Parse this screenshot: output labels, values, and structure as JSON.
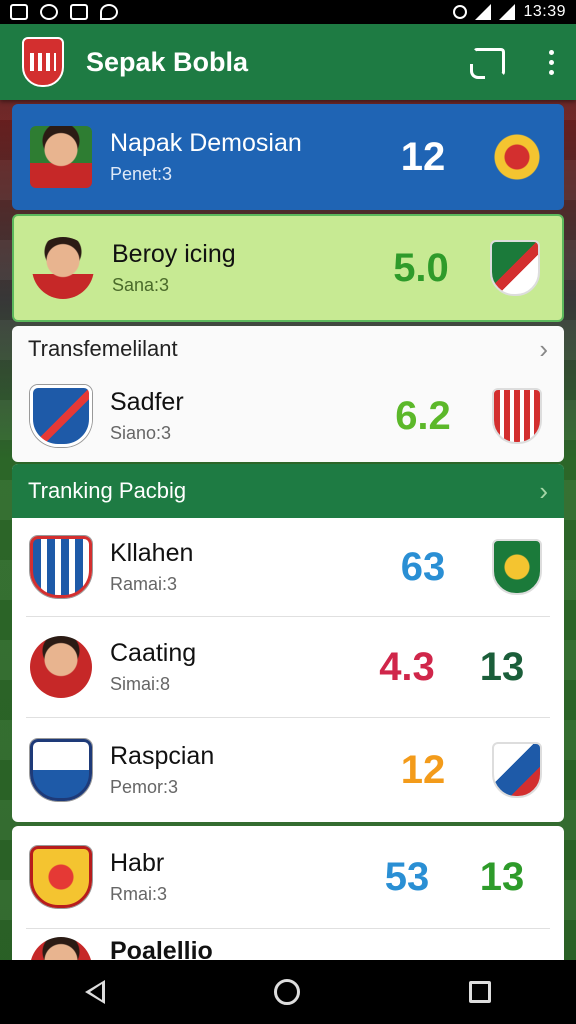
{
  "status_bar": {
    "time": "13:39"
  },
  "app_bar": {
    "title": "Sepak Bobla",
    "actions": [
      "cast-icon",
      "more-vert-icon"
    ]
  },
  "featured": [
    {
      "name": "Napak Demosian",
      "sub": "Penet:3",
      "score": "12",
      "background": "#1f64b4"
    },
    {
      "name": "Beroy icing",
      "sub": "Sana:3",
      "score": "5.0",
      "background": "#c7ea93"
    }
  ],
  "transfer_section": {
    "header": "Transfemelilant",
    "item": {
      "name": "Sadfer",
      "sub": "Siano:3",
      "score": "6.2"
    }
  },
  "ranking_section": {
    "header": "Tranking Pacbig",
    "items": [
      {
        "name": "Kllahen",
        "sub": "Ramai:3",
        "score": "63",
        "score2": "",
        "color": "#2a8fd4"
      },
      {
        "name": "Caating",
        "sub": "Simai:8",
        "score": "4.3",
        "score2": "13",
        "color": "#d0264a"
      },
      {
        "name": "Raspcian",
        "sub": "Pemor:3",
        "score": "12",
        "score2": "",
        "color": "#f39b1a"
      }
    ]
  },
  "bottom_section": {
    "items": [
      {
        "name": "Habr",
        "sub": "Rmai:3",
        "score": "53",
        "score2": "13",
        "color": "#2a8fd4"
      },
      {
        "name": "Poalellio",
        "sub": "",
        "score": "",
        "score2": "",
        "color": "#2a8fd4"
      }
    ]
  },
  "colors": {
    "app_bar": "#1e7b43",
    "green_score": "#2e9b2a",
    "dark_green": "#1b5e3a"
  }
}
